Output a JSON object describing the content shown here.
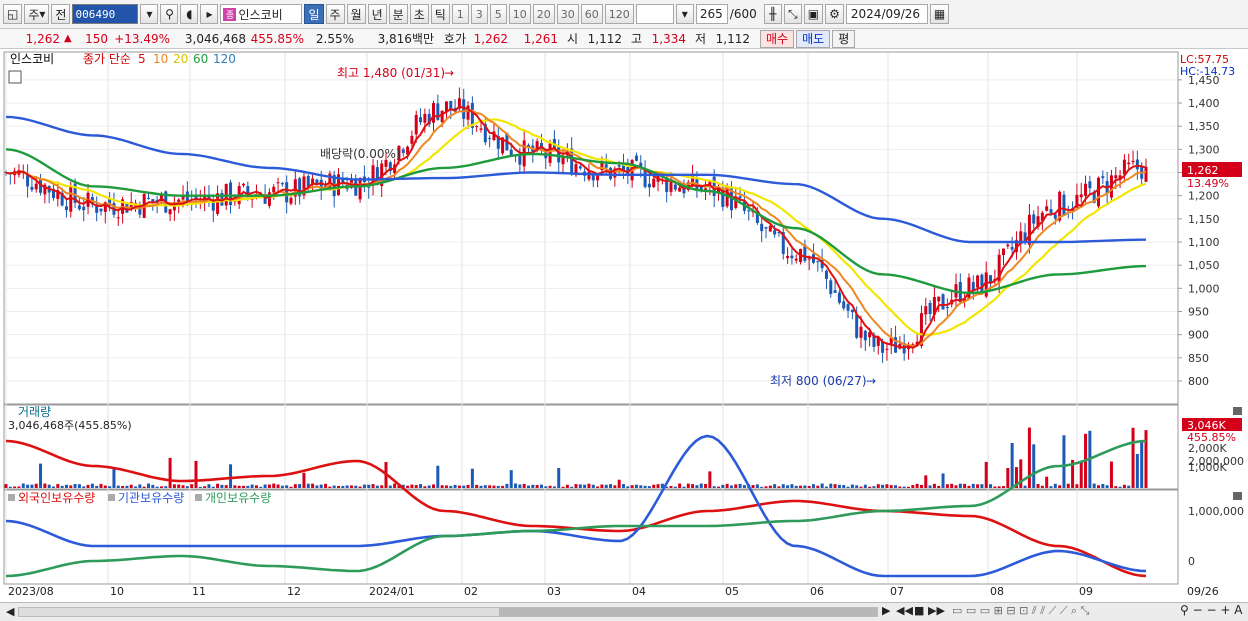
{
  "toolbar": {
    "market": "주",
    "prev": "전",
    "code": "006490",
    "stock_name": "인스코비",
    "name_tag": "종",
    "periods": [
      "일",
      "주",
      "월",
      "년",
      "분",
      "초",
      "틱"
    ],
    "intervals": [
      "1",
      "3",
      "5",
      "10",
      "20",
      "30",
      "60",
      "120"
    ],
    "count_value": "265",
    "count_max": "/600",
    "date": "2024/09/26"
  },
  "quote": {
    "price": "1,262",
    "change": "150",
    "change_pct": "+13.49%",
    "volume": "3,046,468",
    "volume_ratio": "455.85%",
    "turnover": "2.55%",
    "amount": "3,816백만",
    "bid_label": "호가",
    "ask": "1,262",
    "bid": "1,261",
    "open_label": "시",
    "open": "1,112",
    "high_label": "고",
    "high": "1,334",
    "low_label": "저",
    "low": "1,112",
    "buy_label": "매수",
    "sell_label": "매도",
    "eval_label": "평"
  },
  "price_panel": {
    "title": "인스코비",
    "ma_label": "종가 단순",
    "ma_periods": [
      "5",
      "10",
      "20",
      "60",
      "120"
    ],
    "lc": "LC:57.75",
    "hc": "HC:-14.73",
    "high_annotation": "최고 1,480 (01/31)",
    "low_annotation": "최저 800 (06/27)",
    "dividend_annotation": "배당락(0.00%)",
    "current_tag": "1,262",
    "current_pct": "13.49%",
    "y_ticks": [
      "1,450",
      "1,400",
      "1,350",
      "1,300",
      "1,250",
      "1,200",
      "1,150",
      "1,100",
      "1,050",
      "1,000",
      "950",
      "900",
      "850",
      "800"
    ]
  },
  "volume_panel": {
    "title": "거래량",
    "info": "3,046,468주(455.85%)",
    "current_tag": "3,046K",
    "current_pct": "455.85%",
    "y_ticks": [
      "2,000K",
      "1,000K"
    ]
  },
  "holding_panel": {
    "legend": [
      "외국인보유수량",
      "기관보유수량",
      "개인보유수량"
    ],
    "y_ticks": [
      "2,000,000",
      "1,000,000",
      "0"
    ]
  },
  "x_axis": [
    "2023/08",
    "10",
    "11",
    "12",
    "2024/01",
    "02",
    "03",
    "04",
    "05",
    "06",
    "07",
    "08",
    "09",
    "09/26"
  ],
  "colors": {
    "up": "#d4001a",
    "down": "#1a5ab5",
    "ma5": "#dd1111",
    "ma10": "#ee8822",
    "ma20": "#f2e600",
    "ma60": "#1e9b3c",
    "ma120": "#2c5ad8",
    "foreign": "#dd1111",
    "institution": "#2c5ad8",
    "individual": "#2e9b5a"
  },
  "chart_data": {
    "type": "line",
    "title": "인스코비",
    "x": [
      "2023/08",
      "10",
      "11",
      "12",
      "2024/01",
      "02",
      "03",
      "04",
      "05",
      "06",
      "07",
      "08",
      "09",
      "09/26"
    ],
    "series": [
      {
        "name": "종가",
        "values": [
          1250,
          1180,
          1190,
          1205,
          1230,
          1390,
          1290,
          1250,
          1215,
          1080,
          870,
          1000,
          1180,
          1262
        ]
      },
      {
        "name": "60",
        "values": [
          1300,
          1220,
          1200,
          1200,
          1220,
          1260,
          1290,
          1270,
          1210,
          1130,
          1030,
          990,
          1030,
          1048
        ]
      },
      {
        "name": "120",
        "values": [
          1370,
          1330,
          1290,
          1260,
          1235,
          1238,
          1250,
          1245,
          1245,
          1225,
          1150,
          1100,
          1100,
          1105
        ]
      },
      {
        "name": "외국인보유수량",
        "values": [
          2400000,
          1900000,
          1600000,
          1700000,
          2000000,
          1000000,
          700000,
          600000,
          1000000,
          1200000,
          1000000,
          900000,
          300000,
          -300000
        ]
      },
      {
        "name": "기관보유수량",
        "values": [
          800000,
          300000,
          300000,
          300000,
          300000,
          500000,
          600000,
          400000,
          2500000,
          300000,
          -300000,
          -300000,
          200000,
          -200000
        ]
      },
      {
        "name": "개인보유수량",
        "values": [
          -300000,
          0,
          100000,
          -100000,
          -200000,
          500000,
          600000,
          700000,
          700000,
          800000,
          1000000,
          1100000,
          1900000,
          2400000
        ]
      }
    ],
    "high": {
      "value": 1480,
      "date": "01/31"
    },
    "low": {
      "value": 800,
      "date": "06/27"
    },
    "ylim": [
      780,
      1470
    ]
  }
}
